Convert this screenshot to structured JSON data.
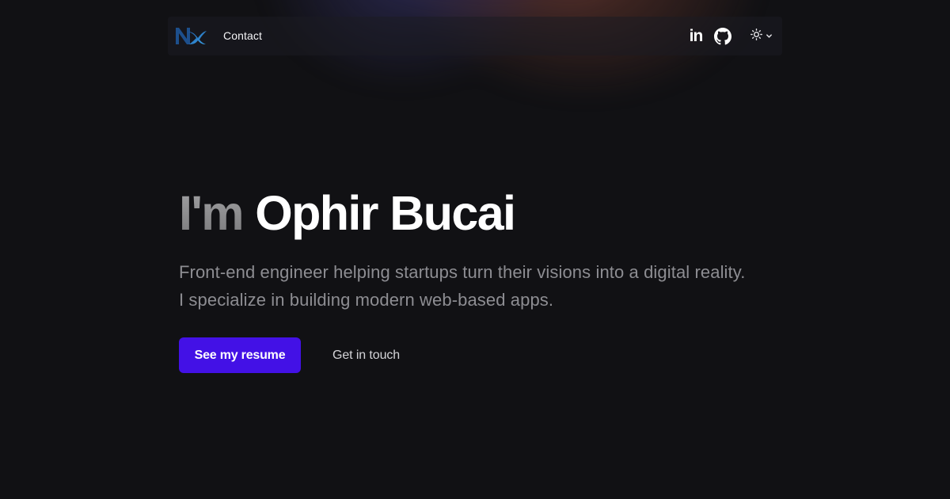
{
  "nav": {
    "logo_icon": "nx-logo",
    "contact_label": "Contact",
    "linkedin_label": "in",
    "github_icon": "github-icon",
    "theme_icon": "sun-icon",
    "theme_dropdown_icon": "chevron-down-icon"
  },
  "hero": {
    "title_prefix": "I'm",
    "title_name": "Ophir Bucai",
    "description": "Front-end engineer helping startups turn their visions into a digital reality. I specialize in building modern web-based apps."
  },
  "actions": {
    "primary_label": "See my resume",
    "secondary_label": "Get in touch"
  },
  "colors": {
    "background": "#111114",
    "accent": "#4311e6",
    "text_primary": "#ffffff",
    "text_muted": "#8d8d92"
  }
}
